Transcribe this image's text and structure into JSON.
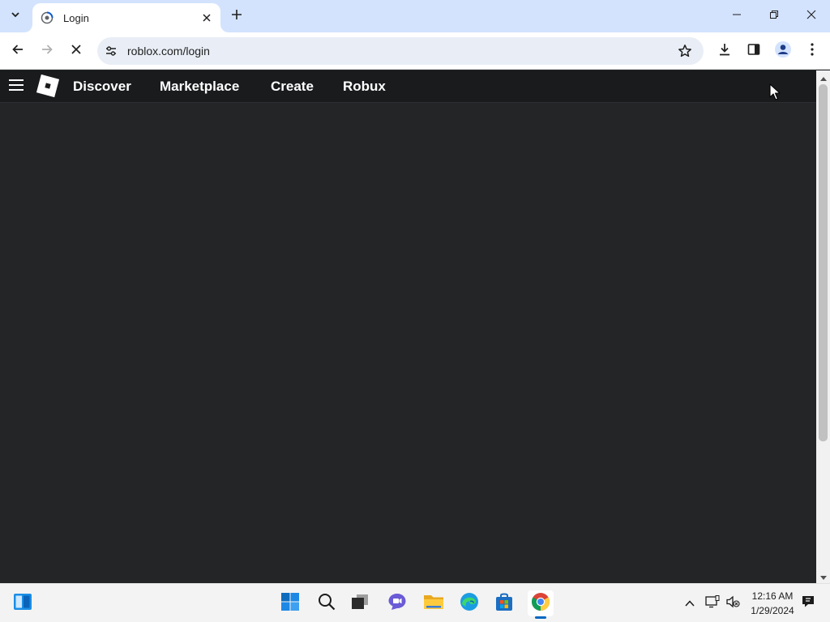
{
  "browser": {
    "tab": {
      "title": "Login"
    },
    "address_bar": {
      "url": "roblox.com/login"
    }
  },
  "roblox_header": {
    "nav": [
      {
        "label": "Discover"
      },
      {
        "label": "Marketplace"
      },
      {
        "label": "Create"
      },
      {
        "label": "Robux"
      }
    ]
  },
  "taskbar": {
    "clock": {
      "time": "12:16 AM",
      "date": "1/29/2024"
    },
    "apps": [
      "widgets-icon",
      "start-icon",
      "search-icon",
      "task-view-icon",
      "teams-chat-icon",
      "file-explorer-icon",
      "edge-icon",
      "store-icon",
      "chrome-icon"
    ]
  },
  "colors": {
    "page_bg": "#232527",
    "header_bg": "#191b1d",
    "tabstrip_bg": "#d3e3fd",
    "omnibox_bg": "#e9eef6"
  }
}
